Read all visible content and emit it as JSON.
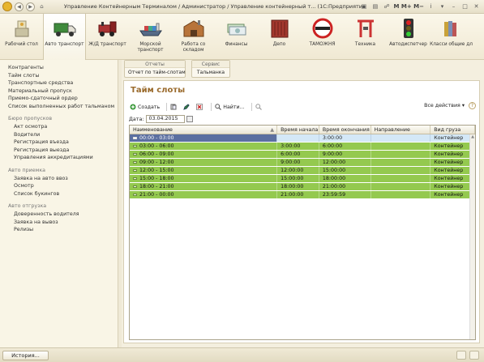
{
  "window": {
    "title": "Управление Контейнерным Терминалом / Администратор / Управление контейнерный т... (1С:Предприятие)",
    "m_buttons": "M  M+  M−",
    "info_glyph": "i"
  },
  "sections": [
    {
      "label": "Рабочий стол",
      "icon": "desktop-icon"
    },
    {
      "label": "Авто транспорт",
      "icon": "truck-icon",
      "active": true
    },
    {
      "label": "Ж/Д транспорт",
      "icon": "locomotive-icon"
    },
    {
      "label": "Морской транспорт",
      "icon": "ship-icon"
    },
    {
      "label": "Работа со складом",
      "icon": "warehouse-icon"
    },
    {
      "label": "Финансы",
      "icon": "money-icon"
    },
    {
      "label": "Депо",
      "icon": "container-icon"
    },
    {
      "label": "ТАМОЖНЯ",
      "icon": "customs-sign-icon"
    },
    {
      "label": "Техника",
      "icon": "crane-icon"
    },
    {
      "label": "Автодиспетчер",
      "icon": "traffic-light-icon"
    },
    {
      "label": "Класси общие дл",
      "icon": "books-icon"
    }
  ],
  "nav": {
    "top_items": [
      "Контрагенты",
      "Тайм слоты",
      "Транспортные средства",
      "Материальный пропуск",
      "Приемо-сдаточный ордер",
      "Список выполненных работ тальманом"
    ],
    "groups": [
      {
        "title": "Бюро пропусков",
        "items": [
          "Акт осмотра",
          "Водители",
          "Регистрация въезда",
          "Регистрация выезда",
          "Управления аккредитациями"
        ]
      },
      {
        "title": "Авто приемка",
        "items": [
          "Заявка на авто ввоз",
          "Осмотр",
          "Список букингов"
        ]
      },
      {
        "title": "Авто отгрузка",
        "items": [
          "Доверенность водителя",
          "Заявка на вывоз",
          "Релизы"
        ]
      }
    ]
  },
  "command_panel": {
    "reports_header": "Отчеты",
    "reports_item": "Отчет по тайм-слотам",
    "service_header": "Сервис",
    "service_item": "Тальманка"
  },
  "form": {
    "title": "Тайм слоты",
    "create_label": "Создать",
    "find_label": "Найти...",
    "all_actions_label": "Все действия",
    "date_label": "Дата:",
    "date_value": "03.04.2015",
    "help_glyph": "?"
  },
  "table": {
    "columns": [
      "Наименование",
      "Время начала",
      "Время окончания",
      "Направление",
      "Вид груза"
    ],
    "rows": [
      {
        "name": "00:00 - 03:00",
        "start": "",
        "end": "3:00:00",
        "direction": "",
        "cargo": "Контейнер",
        "state": "selected"
      },
      {
        "name": "03:00 - 06:00",
        "start": "3:00:00",
        "end": "6:00:00",
        "direction": "",
        "cargo": "Контейнер",
        "state": "green"
      },
      {
        "name": "06:00 - 09:00",
        "start": "6:00:00",
        "end": "9:00:00",
        "direction": "",
        "cargo": "Контейнер",
        "state": "green"
      },
      {
        "name": "09:00 - 12:00",
        "start": "9:00:00",
        "end": "12:00:00",
        "direction": "",
        "cargo": "Контейнер",
        "state": "green"
      },
      {
        "name": "12:00 - 15:00",
        "start": "12:00:00",
        "end": "15:00:00",
        "direction": "",
        "cargo": "Контейнер",
        "state": "green"
      },
      {
        "name": "15:00 - 18:00",
        "start": "15:00:00",
        "end": "18:00:00",
        "direction": "",
        "cargo": "Контейнер",
        "state": "green"
      },
      {
        "name": "18:00 - 21:00",
        "start": "18:00:00",
        "end": "21:00:00",
        "direction": "",
        "cargo": "Контейнер",
        "state": "green"
      },
      {
        "name": "21:00 - 00:00",
        "start": "21:00:00",
        "end": "23:59:59",
        "direction": "",
        "cargo": "Контейнер",
        "state": "green"
      }
    ]
  },
  "status_bar": {
    "history_label": "История..."
  },
  "colors": {
    "row_green": "#94c94f",
    "row_selected": "#5b6fa0",
    "title_accent": "#9a6a2c"
  }
}
